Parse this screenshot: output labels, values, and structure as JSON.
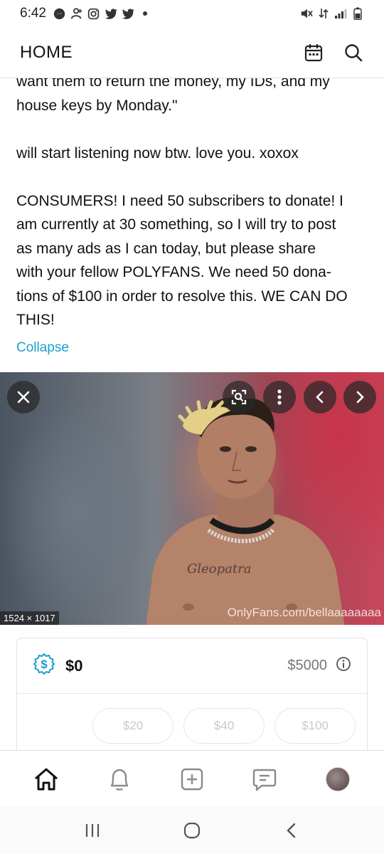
{
  "status_bar": {
    "time": "6:42",
    "icons_left": [
      "messenger-icon",
      "person-add-icon",
      "instagram-icon",
      "twitter-icon",
      "twitter-icon",
      "dot-icon"
    ],
    "icons_right": [
      "mute-icon",
      "data-icon",
      "signal-icon",
      "battery-icon"
    ]
  },
  "header": {
    "title": "HOME",
    "calendar_icon": "calendar-icon",
    "search_icon": "search-icon"
  },
  "post": {
    "lines_block1": [
      "want them to return the money, my IDs, and my",
      "house keys by Monday.\""
    ],
    "line_block2": "will start listening now btw. love you. xoxox",
    "lines_block3": [
      "CONSUMERS! I need 50 subscribers to donate! I",
      "am currently at 30 something, so I will try to post",
      "as many ads as I can today, but please share",
      "with your fellow POLYFANS. We need 50 dona-",
      "tions of $100 in order to resolve this. WE CAN DO",
      "THIS!"
    ],
    "collapse_label": "Collapse"
  },
  "media": {
    "size_label": "1524 × 1017",
    "watermark": "OnlyFans.com/bellaaaaaaaa",
    "chest_tattoo": "Gleopatra",
    "buttons": [
      "close-icon",
      "lens-search-icon",
      "more-vertical-icon",
      "chevron-left-icon",
      "chevron-right-icon"
    ]
  },
  "tip": {
    "amount": "$0",
    "goal": "$5000",
    "presets": [
      "$20",
      "$40",
      "$100"
    ]
  },
  "bottom_nav": [
    "home-icon",
    "bell-icon",
    "add-post-icon",
    "messages-icon",
    "profile-avatar"
  ],
  "system_nav": [
    "recents-icon",
    "home-circle-icon",
    "back-icon"
  ]
}
